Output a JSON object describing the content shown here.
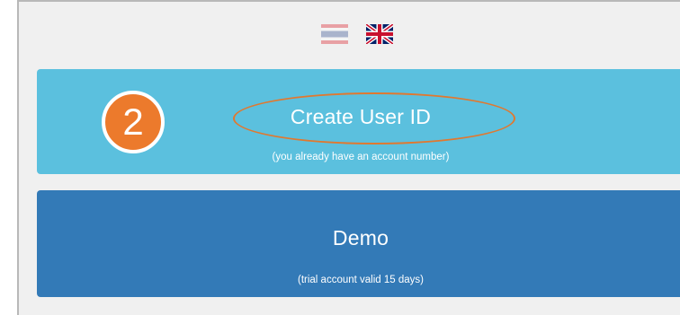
{
  "languages": [
    {
      "code": "th",
      "icon": "thailand-flag-icon"
    },
    {
      "code": "en",
      "icon": "uk-flag-icon"
    }
  ],
  "step_badge": {
    "number": "2",
    "color": "#ec7a2c"
  },
  "create_user": {
    "title": "Create User ID",
    "subtitle": "(you already have an account number)",
    "color": "#5bc0de"
  },
  "demo": {
    "title": "Demo",
    "subtitle": "(trial account valid 15 days)",
    "color": "#337ab7"
  }
}
